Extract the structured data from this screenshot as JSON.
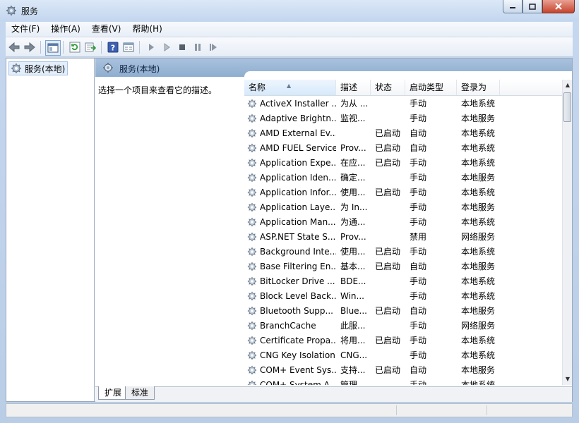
{
  "window": {
    "title": "服务"
  },
  "menu": [
    "文件(F)",
    "操作(A)",
    "查看(V)",
    "帮助(H)"
  ],
  "tree": {
    "root_label": "服务(本地)"
  },
  "panel": {
    "title": "服务(本地)",
    "description_hint": "选择一个项目来查看它的描述。"
  },
  "columns": {
    "name": "名称",
    "desc": "描述",
    "status": "状态",
    "startup": "启动类型",
    "logon": "登录为"
  },
  "services": [
    {
      "name": "ActiveX Installer ...",
      "desc": "为从 ...",
      "status": "",
      "startup": "手动",
      "logon": "本地系统"
    },
    {
      "name": "Adaptive Brightn...",
      "desc": "监视...",
      "status": "",
      "startup": "手动",
      "logon": "本地服务"
    },
    {
      "name": "AMD External Ev...",
      "desc": "",
      "status": "已启动",
      "startup": "自动",
      "logon": "本地系统"
    },
    {
      "name": "AMD FUEL Service",
      "desc": "Prov...",
      "status": "已启动",
      "startup": "自动",
      "logon": "本地系统"
    },
    {
      "name": "Application Expe...",
      "desc": "在应...",
      "status": "已启动",
      "startup": "手动",
      "logon": "本地系统"
    },
    {
      "name": "Application Iden...",
      "desc": "确定...",
      "status": "",
      "startup": "手动",
      "logon": "本地服务"
    },
    {
      "name": "Application Infor...",
      "desc": "使用...",
      "status": "已启动",
      "startup": "手动",
      "logon": "本地系统"
    },
    {
      "name": "Application Laye...",
      "desc": "为 In...",
      "status": "",
      "startup": "手动",
      "logon": "本地服务"
    },
    {
      "name": "Application Man...",
      "desc": "为通...",
      "status": "",
      "startup": "手动",
      "logon": "本地系统"
    },
    {
      "name": "ASP.NET State S...",
      "desc": "Prov...",
      "status": "",
      "startup": "禁用",
      "logon": "网络服务"
    },
    {
      "name": "Background Inte...",
      "desc": "使用...",
      "status": "已启动",
      "startup": "手动",
      "logon": "本地系统"
    },
    {
      "name": "Base Filtering En...",
      "desc": "基本...",
      "status": "已启动",
      "startup": "自动",
      "logon": "本地服务"
    },
    {
      "name": "BitLocker Drive ...",
      "desc": "BDE...",
      "status": "",
      "startup": "手动",
      "logon": "本地系统"
    },
    {
      "name": "Block Level Back...",
      "desc": "Win...",
      "status": "",
      "startup": "手动",
      "logon": "本地系统"
    },
    {
      "name": "Bluetooth Supp...",
      "desc": "Blue...",
      "status": "已启动",
      "startup": "自动",
      "logon": "本地服务"
    },
    {
      "name": "BranchCache",
      "desc": "此服...",
      "status": "",
      "startup": "手动",
      "logon": "网络服务"
    },
    {
      "name": "Certificate Propa...",
      "desc": "将用...",
      "status": "已启动",
      "startup": "手动",
      "logon": "本地系统"
    },
    {
      "name": "CNG Key Isolation",
      "desc": "CNG...",
      "status": "",
      "startup": "手动",
      "logon": "本地系统"
    },
    {
      "name": "COM+ Event Sys...",
      "desc": "支持...",
      "status": "已启动",
      "startup": "自动",
      "logon": "本地服务"
    },
    {
      "name": "COM+ System A...",
      "desc": "管理...",
      "status": "",
      "startup": "手动",
      "logon": "本地系统"
    }
  ],
  "tabs": [
    "扩展",
    "标准"
  ]
}
